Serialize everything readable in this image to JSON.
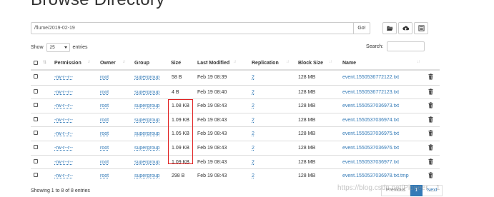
{
  "page": {
    "title": "Browse Directory"
  },
  "path_bar": {
    "value": "/flume/2019-02-19",
    "go_label": "Go!"
  },
  "toolbar": {
    "buttons": [
      {
        "icon": "folder-open-icon"
      },
      {
        "icon": "upload-icon"
      },
      {
        "icon": "list-icon"
      }
    ]
  },
  "length_control": {
    "prefix": "Show",
    "selected": "25",
    "suffix": "entries"
  },
  "search": {
    "label": "Search:",
    "value": ""
  },
  "table": {
    "headers": {
      "permission": "Permission",
      "owner": "Owner",
      "group": "Group",
      "size": "Size",
      "last_modified": "Last Modified",
      "replication": "Replication",
      "block_size": "Block Size",
      "name": "Name"
    },
    "rows": [
      {
        "permission": "-rw-r--r--",
        "owner": "root",
        "group": "supergroup",
        "size": "58 B",
        "last_modified": "Feb 19 08:39",
        "replication": "2",
        "block_size": "128 MB",
        "name": "event.1550536772122.txt"
      },
      {
        "permission": "-rw-r--r--",
        "owner": "root",
        "group": "supergroup",
        "size": "4 B",
        "last_modified": "Feb 19 08:40",
        "replication": "2",
        "block_size": "128 MB",
        "name": "event.1550536772123.txt"
      },
      {
        "permission": "-rw-r--r--",
        "owner": "root",
        "group": "supergroup",
        "size": "1.08 KB",
        "last_modified": "Feb 19 08:43",
        "replication": "2",
        "block_size": "128 MB",
        "name": "event.1550537036973.txt"
      },
      {
        "permission": "-rw-r--r--",
        "owner": "root",
        "group": "supergroup",
        "size": "1.09 KB",
        "last_modified": "Feb 19 08:43",
        "replication": "2",
        "block_size": "128 MB",
        "name": "event.1550537036974.txt"
      },
      {
        "permission": "-rw-r--r--",
        "owner": "root",
        "group": "supergroup",
        "size": "1.05 KB",
        "last_modified": "Feb 19 08:43",
        "replication": "2",
        "block_size": "128 MB",
        "name": "event.1550537036975.txt"
      },
      {
        "permission": "-rw-r--r--",
        "owner": "root",
        "group": "supergroup",
        "size": "1.09 KB",
        "last_modified": "Feb 19 08:43",
        "replication": "2",
        "block_size": "128 MB",
        "name": "event.1550537036976.txt"
      },
      {
        "permission": "-rw-r--r--",
        "owner": "root",
        "group": "supergroup",
        "size": "1.09 KB",
        "last_modified": "Feb 19 08:43",
        "replication": "2",
        "block_size": "128 MB",
        "name": "event.1550537036977.txt"
      },
      {
        "permission": "-rw-r--r--",
        "owner": "root",
        "group": "supergroup",
        "size": "298 B",
        "last_modified": "Feb 19 08:43",
        "replication": "2",
        "block_size": "128 MB",
        "name": "event.1550537036978.txt.tmp"
      }
    ]
  },
  "info": {
    "text": "Showing 1 to 8 of 8 entries"
  },
  "pagination": {
    "previous": "Previous",
    "current": "1",
    "next": "Next"
  },
  "watermark": {
    "text": "https://blog.csdn.net/Pioneer__1"
  },
  "colors": {
    "link": "#337ab7",
    "highlight_box": "#e02020",
    "active_page": "#337ab7"
  }
}
